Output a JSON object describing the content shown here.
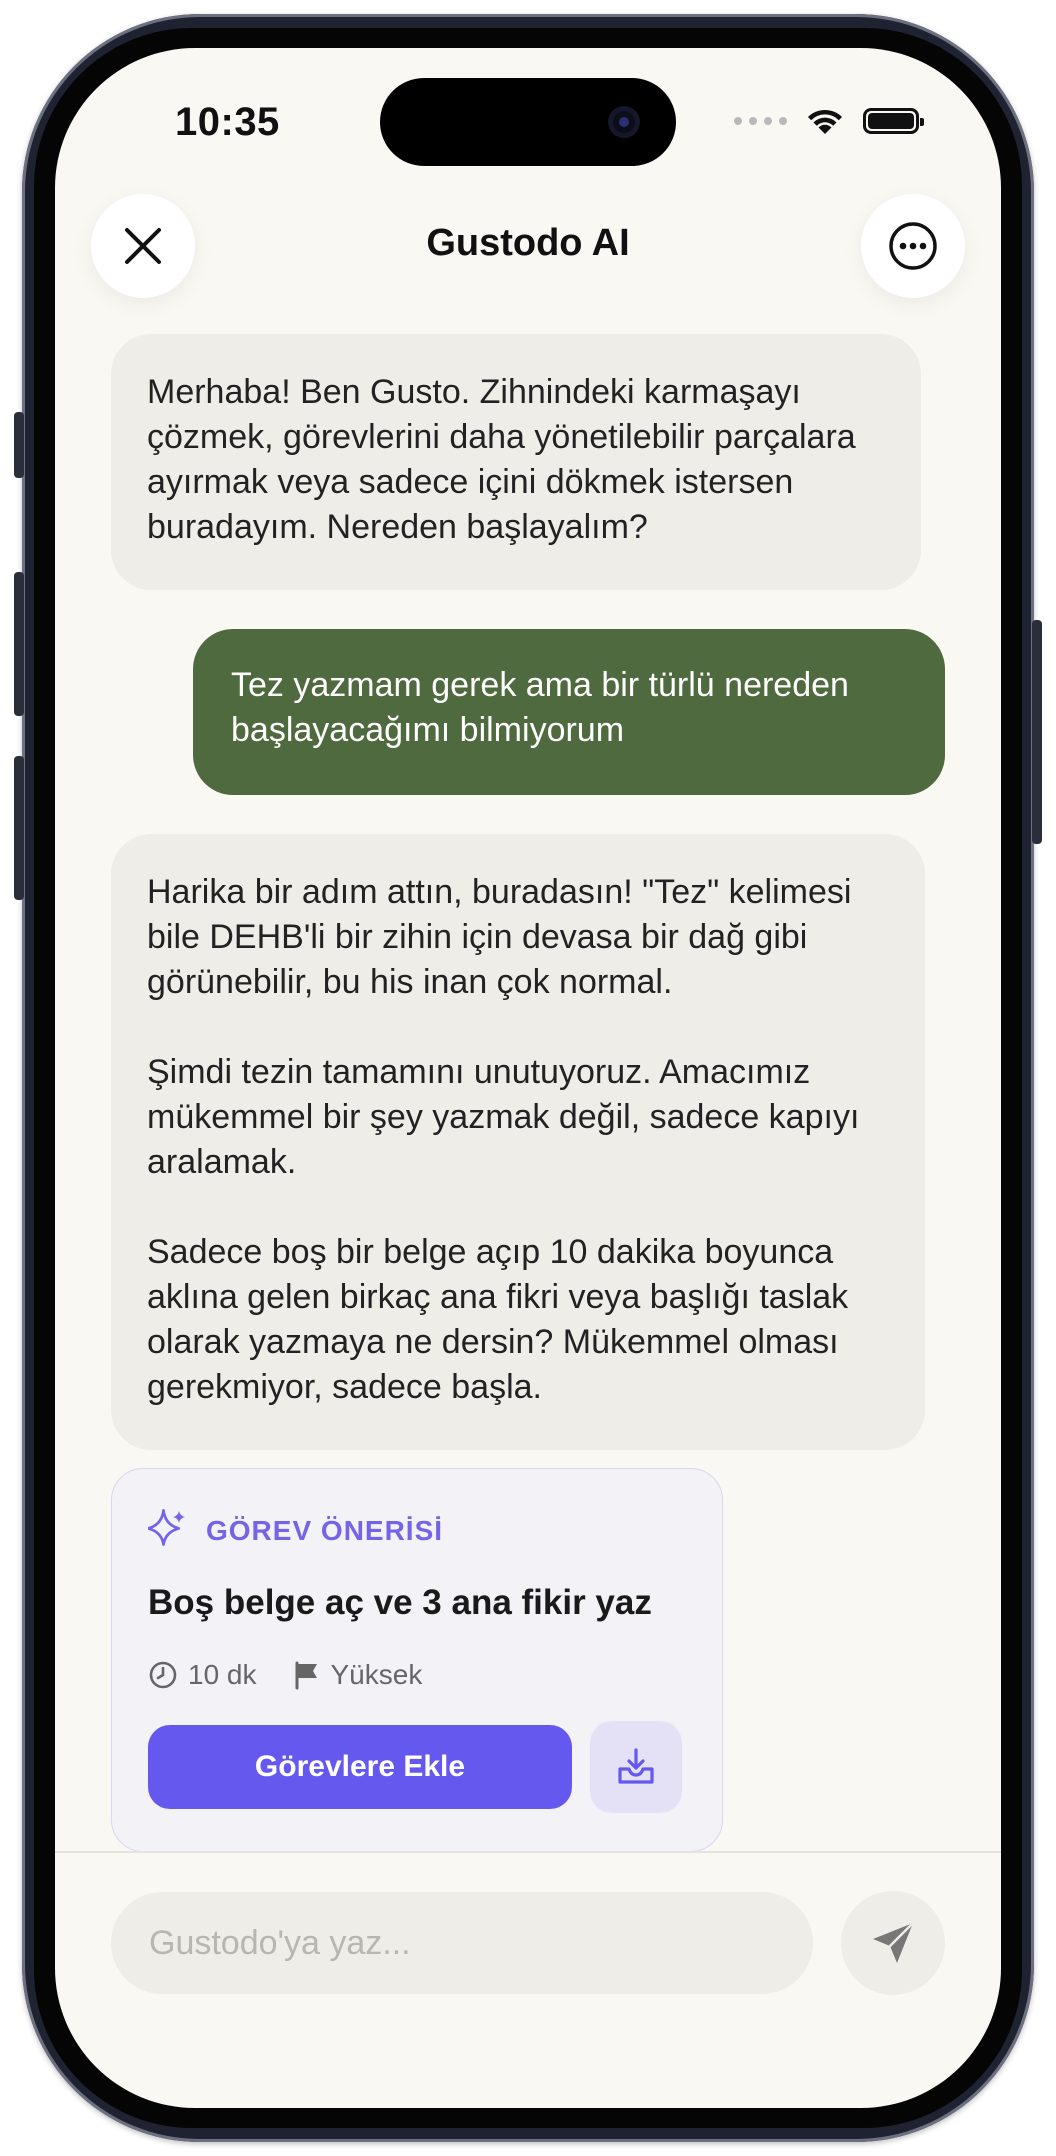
{
  "status_bar": {
    "time": "10:35"
  },
  "header": {
    "title": "Gustodo AI"
  },
  "messages": [
    {
      "role": "bot",
      "text": "Merhaba! Ben Gusto. Zihnindeki karmaşayı çözmek, görevlerini daha yönetilebilir parçalara ayırmak veya sadece içini dökmek istersen buradayım. Nereden başlayalım?"
    },
    {
      "role": "user",
      "text": "Tez yazmam gerek ama bir türlü nereden başlayacağımı bilmiyorum"
    },
    {
      "role": "bot",
      "text": "Harika bir adım attın, buradasın! \"Tez\" kelimesi bile DEHB'li bir zihin için devasa bir dağ gibi görünebilir, bu his inan çok normal.\n\nŞimdi tezin tamamını unutuyoruz. Amacımız mükemmel bir şey yazmak değil, sadece kapıyı aralamak.\n\nSadece boş bir belge açıp 10 dakika boyunca aklına gelen birkaç ana fikri veya başlığı taslak olarak yazmaya ne dersin? Mükemmel olması gerekmiyor, sadece başla."
    }
  ],
  "task_suggestion": {
    "tag": "GÖREV ÖNERİSİ",
    "title": "Boş belge aç ve 3 ana fikir yaz",
    "duration": "10 dk",
    "priority": "Yüksek",
    "add_label": "Görevlere Ekle"
  },
  "composer": {
    "placeholder": "Gustodo'ya yaz..."
  },
  "colors": {
    "accent": "#6558ef",
    "user_bubble": "#4f6a3e",
    "bot_bubble": "#eeede8",
    "background": "#faf8f3"
  }
}
